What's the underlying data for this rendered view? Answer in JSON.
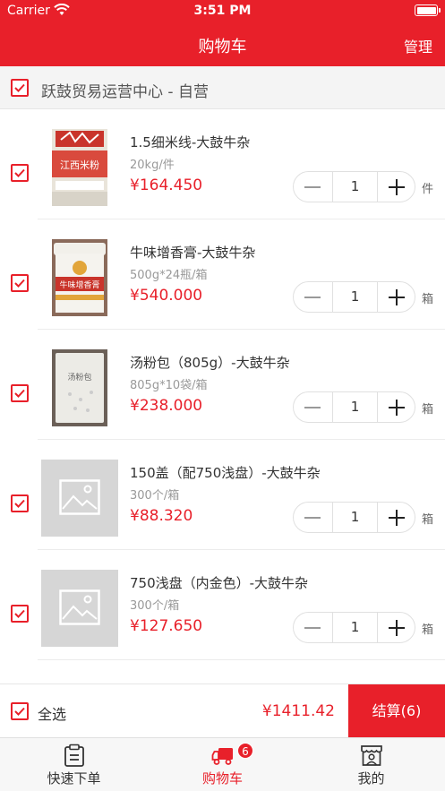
{
  "status_bar": {
    "carrier": "Carrier",
    "time": "3:51 PM"
  },
  "header": {
    "title": "购物车",
    "manage": "管理"
  },
  "shop": {
    "name": "跃鼓贸易运营中心 - 自营",
    "checked": true
  },
  "items": [
    {
      "name": "1.5细米线-大鼓牛杂",
      "spec": "20kg/件",
      "price": "¥164.450",
      "qty": "1",
      "unit": "件",
      "image": "rice-noodle-bag-photo",
      "checked": true
    },
    {
      "name": "牛味增香膏-大鼓牛杂",
      "spec": "500g*24瓶/箱",
      "price": "¥540.000",
      "qty": "1",
      "unit": "箱",
      "image": "beef-paste-jar-photo",
      "checked": true
    },
    {
      "name": "汤粉包（805g）-大鼓牛杂",
      "spec": "805g*10袋/箱",
      "price": "¥238.000",
      "qty": "1",
      "unit": "箱",
      "image": "soup-powder-bag-photo",
      "checked": true
    },
    {
      "name": "150盖（配750浅盘）-大鼓牛杂",
      "spec": "300个/箱",
      "price": "¥88.320",
      "qty": "1",
      "unit": "箱",
      "image": "placeholder-image-icon",
      "checked": true
    },
    {
      "name": "750浅盘（内金色）-大鼓牛杂",
      "spec": "300个/箱",
      "price": "¥127.650",
      "qty": "1",
      "unit": "箱",
      "image": "placeholder-image-icon",
      "checked": true
    }
  ],
  "summary": {
    "select_all": "全选",
    "total": "¥1411.42",
    "checkout": "结算(6)"
  },
  "tabs": [
    {
      "label": "快速下单",
      "icon": "clipboard-icon"
    },
    {
      "label": "购物车",
      "icon": "truck-icon",
      "badge": "6",
      "active": true
    },
    {
      "label": "我的",
      "icon": "store-user-icon"
    }
  ],
  "colors": {
    "accent": "#e8202a"
  },
  "photo_text": {
    "item1": "江西米粉",
    "item2": "牛味增香膏",
    "item3": "汤粉包"
  }
}
